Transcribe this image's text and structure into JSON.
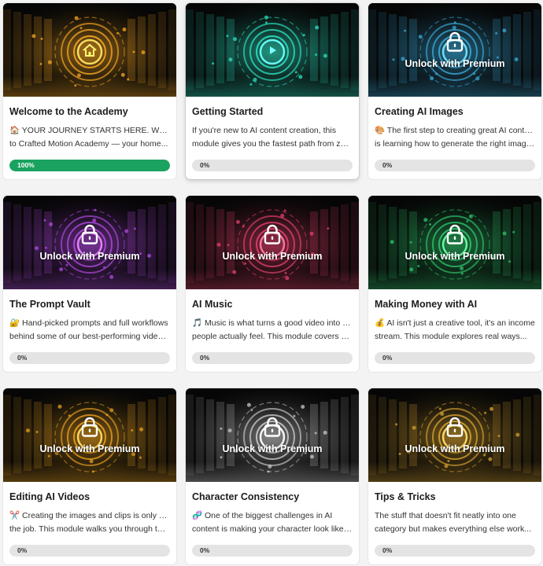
{
  "courses": [
    {
      "title": "Welcome to the Academy",
      "desc_lines": [
        "🏠 YOUR JOURNEY STARTS HERE. Welcome",
        "to Crafted Motion Academy — your home..."
      ],
      "progress_label": "100%",
      "progress": 1.0,
      "locked": false,
      "center_icon": "home-icon",
      "accent": "#f5a623"
    },
    {
      "title": "Getting Started",
      "desc_lines": [
        "If you're new to AI content creation, this",
        "module gives you the fastest path from zer..."
      ],
      "progress_label": "0%",
      "progress": 0,
      "locked": false,
      "center_icon": "play-icon",
      "accent": "#2de0c0"
    },
    {
      "title": "Creating AI Images",
      "desc_lines": [
        "🎨 The first step to creating great AI content",
        "is learning how to generate the right images..."
      ],
      "progress_label": "0%",
      "progress": 0,
      "locked": true,
      "lock_label": "Unlock with Premium",
      "accent": "#3aa9d8"
    },
    {
      "title": "The Prompt Vault",
      "desc_lines": [
        "🔐 Hand-picked prompts and full workflows",
        "behind some of our best-performing videos...."
      ],
      "progress_label": "0%",
      "progress": 0,
      "locked": true,
      "lock_label": "Unlock with Premium",
      "accent": "#b04ae0"
    },
    {
      "title": "AI Music",
      "desc_lines": [
        "🎵 Music is what turns a good video into one",
        "people actually feel. This module covers ho..."
      ],
      "progress_label": "0%",
      "progress": 0,
      "locked": true,
      "lock_label": "Unlock with Premium",
      "accent": "#e0406a"
    },
    {
      "title": "Making Money with AI",
      "desc_lines": [
        "💰 AI isn't just a creative tool, it's an income",
        "stream. This module explores real ways..."
      ],
      "progress_label": "0%",
      "progress": 0,
      "locked": true,
      "lock_label": "Unlock with Premium",
      "accent": "#2ec46a"
    },
    {
      "title": "Editing AI Videos",
      "desc_lines": [
        "✂️ Creating the images and clips is only half",
        "the job. This module walks you through the..."
      ],
      "progress_label": "0%",
      "progress": 0,
      "locked": true,
      "lock_label": "Unlock with Premium",
      "accent": "#e8a020"
    },
    {
      "title": "Character Consistency",
      "desc_lines": [
        "🧬 One of the biggest challenges in AI",
        "content is making your character look like t..."
      ],
      "progress_label": "0%",
      "progress": 0,
      "locked": true,
      "lock_label": "Unlock with Premium",
      "accent": "#c8c8c8"
    },
    {
      "title": "Tips & Tricks",
      "desc_lines": [
        "The stuff that doesn't fit neatly into one",
        "category but makes everything else work..."
      ],
      "progress_label": "0%",
      "progress": 0,
      "locked": true,
      "lock_label": "Unlock with Premium",
      "accent": "#d4a030"
    }
  ],
  "colors": {
    "progress_complete": "#1aa260",
    "progress_track": "#e4e4e4"
  }
}
